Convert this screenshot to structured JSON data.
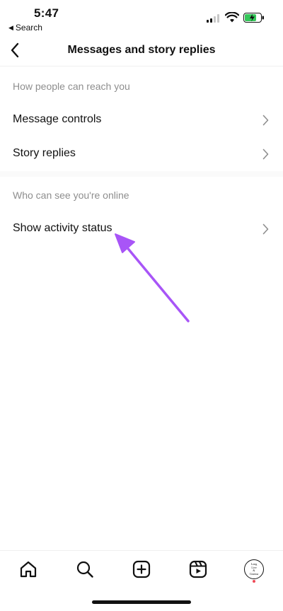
{
  "status_bar": {
    "time": "5:47",
    "back_app": "Search",
    "back_glyph": "◀"
  },
  "header": {
    "title": "Messages and story replies",
    "back_icon": "chevron-left-icon"
  },
  "sections": [
    {
      "title": "How people can reach you",
      "rows": [
        {
          "label": "Message controls"
        },
        {
          "label": "Story replies"
        }
      ]
    },
    {
      "title": "Who can see you're online",
      "rows": [
        {
          "label": "Show activity status"
        }
      ]
    }
  ],
  "annotation": {
    "color": "#a855f7",
    "icon": "arrow-annotation"
  },
  "bottom_nav": {
    "items": [
      "home-icon",
      "search-icon",
      "create-icon",
      "reels-icon",
      "profile-avatar"
    ],
    "avatar_text": [
      "Long",
      "Live",
      "&",
      "Cinema"
    ],
    "notification_color": "#ed4956"
  },
  "colors": {
    "section_title": "#8e8e8e",
    "text": "#111111",
    "battery_green": "#34c759"
  }
}
